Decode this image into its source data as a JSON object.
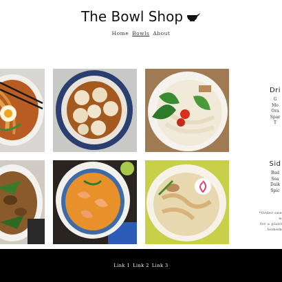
{
  "header": {
    "title": "The Bowl Shop",
    "logo_icon": "bowl-icon"
  },
  "nav": {
    "items": [
      "Home",
      "Bowls",
      "About"
    ],
    "active": "Bowls"
  },
  "sidebar": {
    "drinks": {
      "heading": "Dri",
      "items": [
        "G",
        "Mo",
        "Ora",
        "Spar",
        "T"
      ]
    },
    "sides": {
      "heading": "Sid",
      "items": [
        "Bud",
        "Sea",
        "Daik",
        "Spic"
      ]
    },
    "note": [
      "*Order one w",
      "for a plant",
      "homem"
    ]
  },
  "footer": {
    "links": [
      "Link 1",
      "Link 2",
      "Link 3"
    ]
  },
  "colors": {
    "footer_bg": "#000000",
    "page_bg": "#ffffff"
  }
}
